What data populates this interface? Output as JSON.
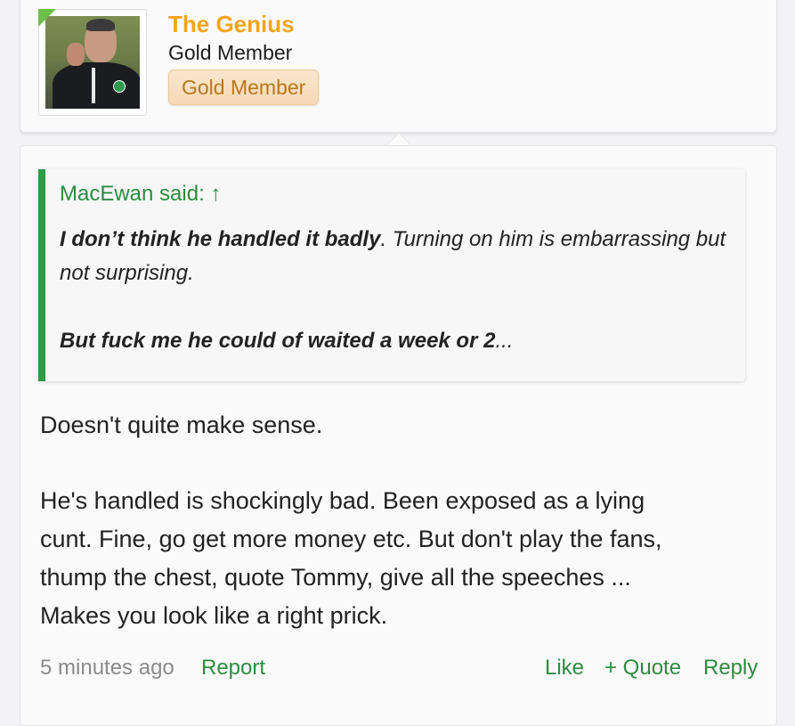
{
  "user": {
    "name": "The Genius",
    "title": "Gold Member",
    "banner": "Gold Member"
  },
  "quote": {
    "attribution": "MacEwan said: ↑",
    "line1_bold": "I don’t think he handled it badly",
    "line1_rest": ". Turning on him is embarrassing but not surprising.",
    "line2_bold": "But fuck me he could of waited a week or 2",
    "line2_rest": "..."
  },
  "message": {
    "para1": "Doesn't quite make sense.",
    "para2_line1": "He's handled is shockingly bad. Been exposed as a lying",
    "para2_line2": "cunt. Fine, go get more money etc. But don't play the fans,",
    "para2_line3": "thump the chest, quote Tommy, give all the speeches ...",
    "para2_line4": "Makes you look like a right prick."
  },
  "footer": {
    "time": "5 minutes ago",
    "report": "Report",
    "like": "Like",
    "quote": "+ Quote",
    "reply": "Reply"
  },
  "colors": {
    "username": "#f4a41c",
    "accent_green": "#2e8b3e",
    "quote_bar": "#2e9a44",
    "online_flag": "#6cc04a"
  }
}
